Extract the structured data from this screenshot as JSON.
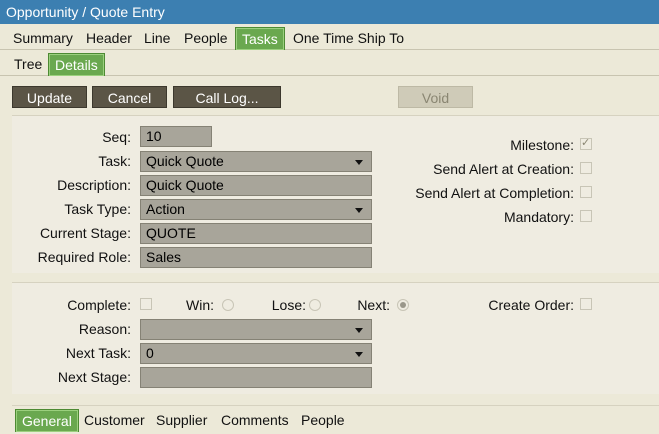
{
  "window": {
    "title": "Opportunity / Quote Entry"
  },
  "main_tabs": [
    "Summary",
    "Header",
    "Line",
    "People",
    "Tasks",
    "One Time Ship To"
  ],
  "sub_tabs": [
    "Tree",
    "Details"
  ],
  "toolbar": {
    "update": "Update",
    "cancel": "Cancel",
    "call_log": "Call Log...",
    "void": "Void"
  },
  "task": {
    "seq_label": "Seq:",
    "seq": "10",
    "task_label": "Task:",
    "task": "Quick Quote",
    "description_label": "Description:",
    "description": "Quick Quote",
    "task_type_label": "Task Type:",
    "task_type": "Action",
    "current_stage_label": "Current Stage:",
    "current_stage": "QUOTE",
    "required_role_label": "Required Role:",
    "required_role": "Sales"
  },
  "flags": {
    "milestone_label": "Milestone:",
    "milestone": true,
    "alert_creation_label": "Send Alert at Creation:",
    "alert_creation": false,
    "alert_completion_label": "Send Alert at Completion:",
    "alert_completion": false,
    "mandatory_label": "Mandatory:",
    "mandatory": false
  },
  "completion": {
    "complete_label": "Complete:",
    "complete": false,
    "win_label": "Win:",
    "lose_label": "Lose:",
    "next_label": "Next:",
    "outcome": "Next",
    "create_order_label": "Create Order:",
    "create_order": false,
    "reason_label": "Reason:",
    "reason": "",
    "next_task_label": "Next Task:",
    "next_task": "0",
    "next_stage_label": "Next Stage:",
    "next_stage": ""
  },
  "bottom_tabs": [
    "General",
    "Customer",
    "Supplier",
    "Comments",
    "People"
  ],
  "colors": {
    "title_bar": "#3c7fb1",
    "active_tab": "#6aa84f",
    "button": "#5b5546"
  }
}
